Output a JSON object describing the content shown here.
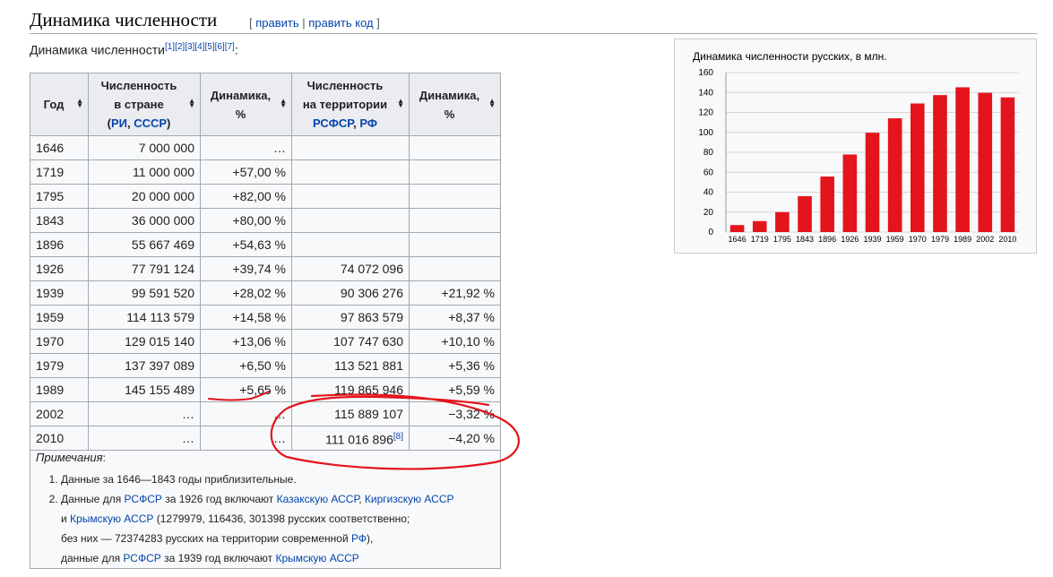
{
  "section": {
    "title": "Динамика численности",
    "edit_open": "[ ",
    "edit_label": "править",
    "separator": " | ",
    "edit_code_label": "править код",
    "edit_close": " ]"
  },
  "intro": {
    "text": "Динамика численности",
    "refs": [
      "[1]",
      "[2]",
      "[3]",
      "[4]",
      "[5]",
      "[6]",
      "[7]"
    ],
    "colon": ":"
  },
  "table": {
    "headers": {
      "year": "Год",
      "pop_country_line1": "Численность",
      "pop_country_line2": "в стране",
      "pop_country_open": "(",
      "pop_country_link1": "РИ",
      "pop_country_comma": ", ",
      "pop_country_link2": "СССР",
      "pop_country_close": ")",
      "dyn1": "Динамика, %",
      "pop_rsfsr_line1": "Численность",
      "pop_rsfsr_line2": "на территории",
      "pop_rsfsr_link1": "РСФСР",
      "pop_rsfsr_comma": ", ",
      "pop_rsfsr_link2": "РФ",
      "dyn2": "Динамика, %"
    },
    "rows": [
      {
        "year": "1646",
        "pop": "7 000 000",
        "dyn": "…",
        "pop_rf": "",
        "dyn_rf": ""
      },
      {
        "year": "1719",
        "pop": "11 000 000",
        "dyn": "+57,00 %",
        "pop_rf": "",
        "dyn_rf": ""
      },
      {
        "year": "1795",
        "pop": "20 000 000",
        "dyn": "+82,00 %",
        "pop_rf": "",
        "dyn_rf": ""
      },
      {
        "year": "1843",
        "pop": "36 000 000",
        "dyn": "+80,00 %",
        "pop_rf": "",
        "dyn_rf": ""
      },
      {
        "year": "1896",
        "pop": "55 667 469",
        "dyn": "+54,63 %",
        "pop_rf": "",
        "dyn_rf": ""
      },
      {
        "year": "1926",
        "pop": "77 791 124",
        "dyn": "+39,74 %",
        "pop_rf": "74 072 096",
        "dyn_rf": ""
      },
      {
        "year": "1939",
        "pop": "99 591 520",
        "dyn": "+28,02 %",
        "pop_rf": "90 306 276",
        "dyn_rf": "+21,92 %"
      },
      {
        "year": "1959",
        "pop": "114 113 579",
        "dyn": "+14,58 %",
        "pop_rf": "97 863 579",
        "dyn_rf": "+8,37 %"
      },
      {
        "year": "1970",
        "pop": "129 015 140",
        "dyn": "+13,06 %",
        "pop_rf": "107 747 630",
        "dyn_rf": "+10,10 %"
      },
      {
        "year": "1979",
        "pop": "137 397 089",
        "dyn": "+6,50 %",
        "pop_rf": "113 521 881",
        "dyn_rf": "+5,36 %"
      },
      {
        "year": "1989",
        "pop": "145 155 489",
        "dyn": "+5,65 %",
        "pop_rf": "119 865 946",
        "dyn_rf": "+5,59 %"
      },
      {
        "year": "2002",
        "pop": "…",
        "dyn": "…",
        "pop_rf": "115 889 107",
        "dyn_rf": "−3,32 %"
      },
      {
        "year": "2010",
        "pop": "…",
        "dyn": "…",
        "pop_rf": "111 016 896",
        "pop_rf_ref": "[8]",
        "dyn_rf": "−4,20 %"
      }
    ],
    "notes": {
      "title": "Примечания",
      "title_colon": ":",
      "item1": "Данные за 1646—1843 годы приблизительные.",
      "item2": {
        "t1": "Данные для ",
        "l1": "РСФСР",
        "t2": " за 1926 год включают ",
        "l2": "Казакскую АССР",
        "t3": ", ",
        "l3": "Киргизскую АССР",
        "t4": "и ",
        "l4": "Крымскую АССР",
        "t5": " (1279979, 116436, 301398 русских соответственно;",
        "t6": "без них — 72374283 русских на территории современной ",
        "l5": "РФ",
        "t7": "),",
        "t8": "данные для ",
        "l6": "РСФСР",
        "t9": " за 1939 год включают ",
        "l7": "Крымскую АССР"
      }
    }
  },
  "chart_data": {
    "type": "bar",
    "title": "Динамика численности русских, в млн.",
    "categories": [
      "1646",
      "1719",
      "1795",
      "1843",
      "1896",
      "1926",
      "1939",
      "1959",
      "1970",
      "1979",
      "1989",
      "2002",
      "2010"
    ],
    "values": [
      7,
      11,
      20,
      36,
      55.7,
      77.8,
      99.6,
      114.1,
      129.0,
      137.4,
      145.2,
      139.7,
      135.1
    ],
    "ylim": [
      0,
      160
    ],
    "yticks": [
      0,
      20,
      40,
      60,
      80,
      100,
      120,
      140,
      160
    ],
    "ytick_labels": [
      "0",
      "20",
      "40",
      "60",
      "80",
      "100",
      "120",
      "140",
      "160"
    ],
    "bar_color": "#e3141b",
    "grid": true,
    "xlabel": "",
    "ylabel": ""
  },
  "colors": {
    "link": "#0645ad",
    "annotation": "#e3141b",
    "header_bg": "#eaecf0"
  }
}
